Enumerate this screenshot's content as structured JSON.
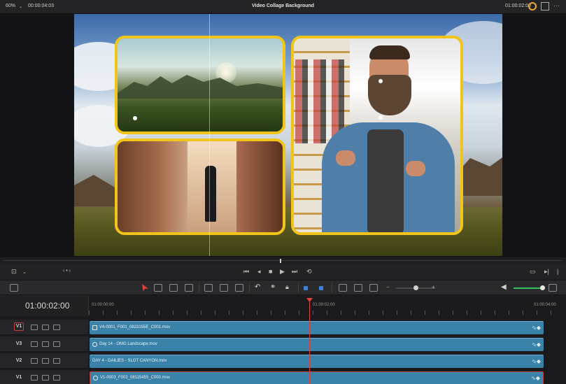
{
  "top_bar": {
    "zoom": "60%",
    "timecode_left": "00:00:04:03",
    "project_title": "Video Collage Background",
    "timecode_right": "01:00:02:00"
  },
  "timeline": {
    "current_timecode": "01:00:02:00",
    "ruler_labels": [
      "01:00:00:00",
      "01:00:02:00",
      "01:00:04:00"
    ],
    "tracks": [
      {
        "name": "V1",
        "clip": "V4-0001_F001_0823155E_C001.mov"
      },
      {
        "name": "V3",
        "clip": "Day 14 - OMG Landscape.mov"
      },
      {
        "name": "V2",
        "clip": "DAY 4 - DAILIES - SLOT CANYON.mov"
      },
      {
        "name": "V1",
        "clip": "V1-0003_F002_08115455_C000.mov"
      }
    ]
  },
  "colors": {
    "tile_border": "#f0c419",
    "clip": "#3a82a8",
    "playhead": "#e0423b",
    "volume": "#35c05a"
  },
  "icons": {
    "transport": [
      "loop-icon",
      "first-frame-icon",
      "prev-frame-icon",
      "stop-icon",
      "play-icon",
      "next-frame-icon",
      "last-frame-icon"
    ]
  }
}
